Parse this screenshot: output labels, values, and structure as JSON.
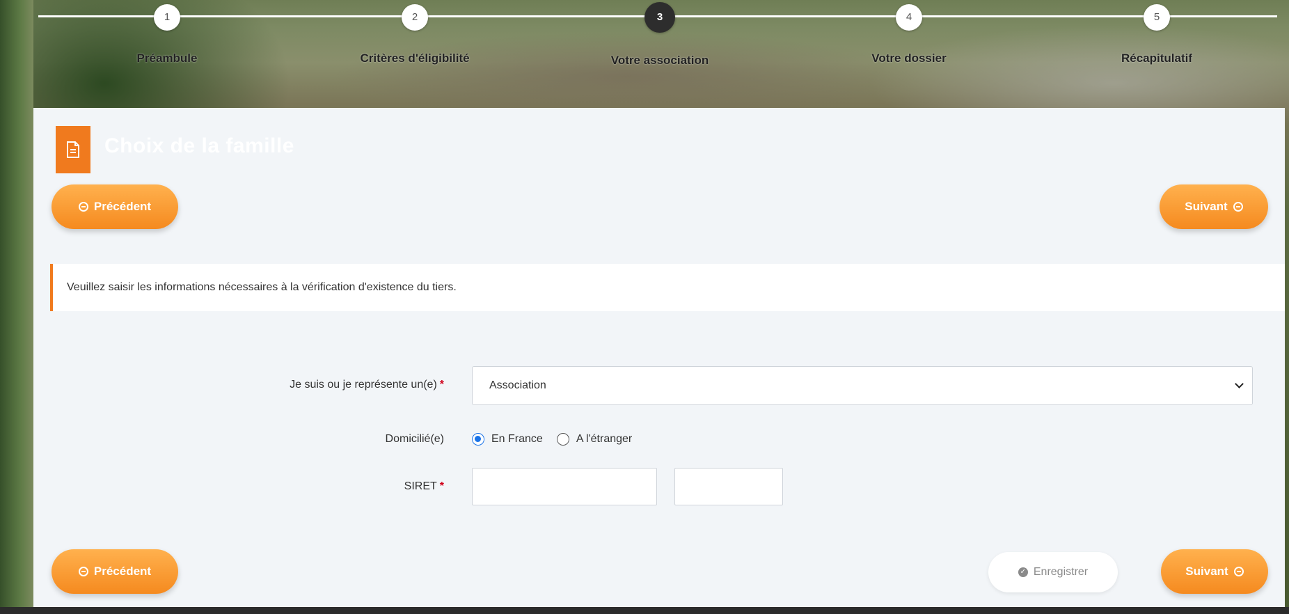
{
  "stepper": {
    "steps": [
      {
        "number": "1",
        "label": "Préambule"
      },
      {
        "number": "2",
        "label": "Critères d'éligibilité"
      },
      {
        "number": "3",
        "label": "Votre association"
      },
      {
        "number": "4",
        "label": "Votre dossier"
      },
      {
        "number": "5",
        "label": "Récapitulatif"
      }
    ],
    "active_step": 3
  },
  "panel": {
    "title": "Choix de la famille",
    "icon": "document-icon"
  },
  "nav": {
    "previous_label": "Précédent",
    "next_label": "Suivant",
    "save_label": "Enregistrer"
  },
  "info": {
    "message": "Veuillez saisir les informations nécessaires à la vérification d'existence du tiers."
  },
  "form": {
    "type_label": "Je suis ou je représente un(e)",
    "type_value": "Association",
    "domicile_label": "Domicilié(e)",
    "domicile_options": [
      "En France",
      "A l'étranger"
    ],
    "domicile_selected": "En France",
    "siret_label": "SIRET",
    "siret_value_1": "",
    "siret_value_2": ""
  },
  "colors": {
    "accent": "#f07a1e",
    "button_gradient_top": "#ffb14e",
    "button_gradient_bottom": "#f58a1f",
    "required": "#d0021b",
    "radio_selected": "#1a73e8"
  }
}
